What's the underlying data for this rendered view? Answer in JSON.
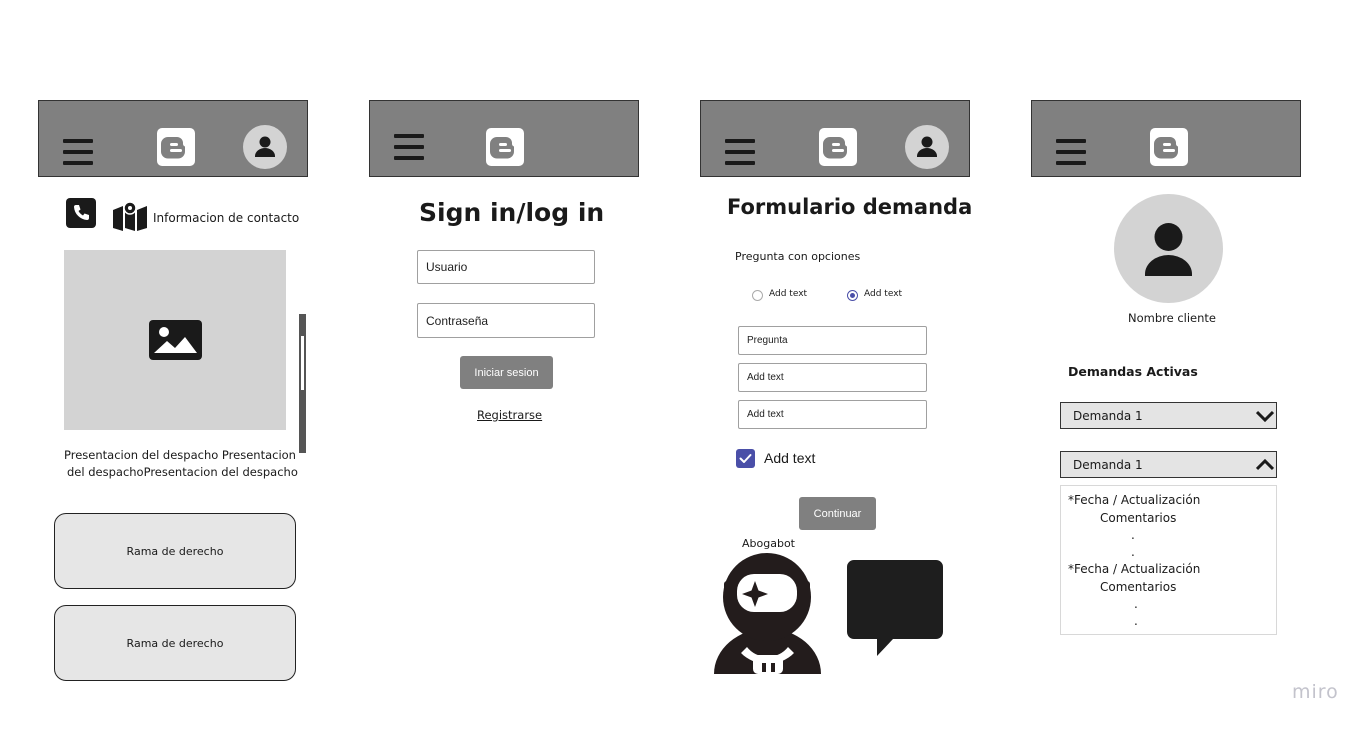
{
  "frame1": {
    "contact_label": "Informacion de contacto",
    "presentation_line1": "Presentacion del despacho Presentacion",
    "presentation_line2": "del despachoPresentacion del despacho",
    "rama_cards": [
      "Rama de derecho",
      "Rama de derecho"
    ]
  },
  "frame2": {
    "title": "Sign in/log in",
    "usuario_value": "Usuario",
    "password_value": "Contraseña",
    "login_button": "Iniciar sesion",
    "register_link": "Registrarse"
  },
  "frame3": {
    "title": "Formulario demanda",
    "question_label": "Pregunta con opciones",
    "radio_options": [
      {
        "label": "Add text",
        "selected": false
      },
      {
        "label": "Add text",
        "selected": true
      }
    ],
    "fields": [
      "Pregunta",
      "Add text",
      "Add text"
    ],
    "checkbox_label": "Add text",
    "checkbox_checked": true,
    "continue_button": "Continuar",
    "bot_label": "Abogabot"
  },
  "frame4": {
    "client_name": "Nombre cliente",
    "section_title": "Demandas Activas",
    "dropdown_collapsed": "Demanda 1",
    "dropdown_expanded": "Demanda 1",
    "details": [
      {
        "fecha": "*Fecha / Actualización",
        "comentarios": "Comentarios",
        "dots": [
          ".",
          "."
        ]
      },
      {
        "fecha": "*Fecha / Actualización",
        "comentarios": "Comentarios",
        "dots": [
          ".",
          "."
        ]
      }
    ]
  },
  "watermark": "miro",
  "colors": {
    "header_gray": "#808080",
    "placeholder_gray": "#d3d3d3",
    "accent_purple": "#4a4fa8",
    "dropdown_fill": "#e4e4e4"
  },
  "icons": [
    "menu-icon",
    "logo-icon",
    "avatar-icon",
    "phone-icon",
    "map-icon",
    "image-icon",
    "astronaut-icon",
    "chat-bubble-icon",
    "chevron-down-icon",
    "chevron-up-icon",
    "check-icon"
  ]
}
